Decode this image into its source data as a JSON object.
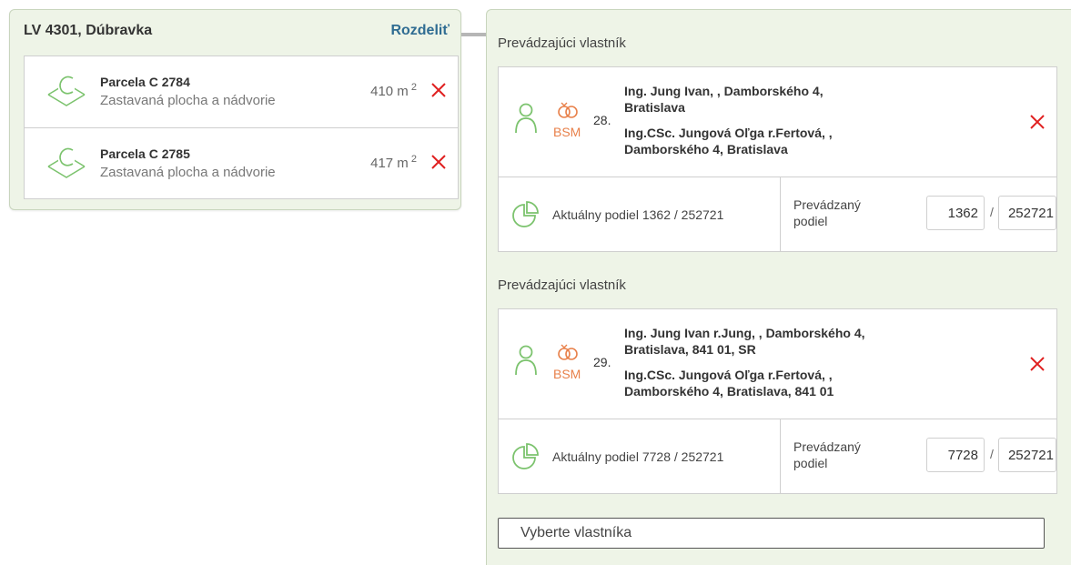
{
  "lv": {
    "title": "LV 4301, Dúbravka",
    "split_label": "Rozdeliť",
    "parcels": [
      {
        "name": "Parcela C 2784",
        "type": "Zastavaná plocha a nádvorie",
        "area": "410 m",
        "unit_sup": "2"
      },
      {
        "name": "Parcela C 2785",
        "type": "Zastavaná plocha a nádvorie",
        "area": "417 m",
        "unit_sup": "2"
      }
    ]
  },
  "owners": [
    {
      "section_label": "Prevádzajúci vlastník",
      "bsm": "BSM",
      "order": "28.",
      "line1": "Ing. Jung Ivan,                  , Damborského 4,",
      "line2": "Bratislava",
      "line3": "Ing.CSc. Jungová Oľga r.Fertová,                  ,",
      "line4": "Damborského 4, Bratislava",
      "current_share": "Aktuálny podiel  1362 / 252721",
      "transfer_label": "Prevádzaný podiel",
      "numerator": "1362",
      "slash": "/",
      "denominator": "252721"
    },
    {
      "section_label": "Prevádzajúci vlastník",
      "bsm": "BSM",
      "order": "29.",
      "line1": "Ing. Jung Ivan r.Jung,                  , Damborského 4,",
      "line2": "Bratislava, 841 01, SR",
      "line3": "Ing.CSc. Jungová Oľga r.Fertová,                  ,",
      "line4": "Damborského 4, Bratislava, 841 01",
      "current_share": "Aktuálny podiel  7728 / 252721",
      "transfer_label": "Prevádzaný podiel",
      "numerator": "7728",
      "slash": "/",
      "denominator": "252721"
    }
  ],
  "select_owner_label": "Vyberte vlastníka",
  "colors": {
    "panel_bg": "#eef4e7",
    "link": "#2f6c92",
    "green_icon": "#7cc36e",
    "orange": "#e8804a",
    "delete_red": "#e02020"
  },
  "icons": {
    "parcel": "parcel-icon",
    "delete": "close-icon",
    "person": "person-icon",
    "rings": "rings-icon",
    "pie": "pie-chart-icon"
  }
}
